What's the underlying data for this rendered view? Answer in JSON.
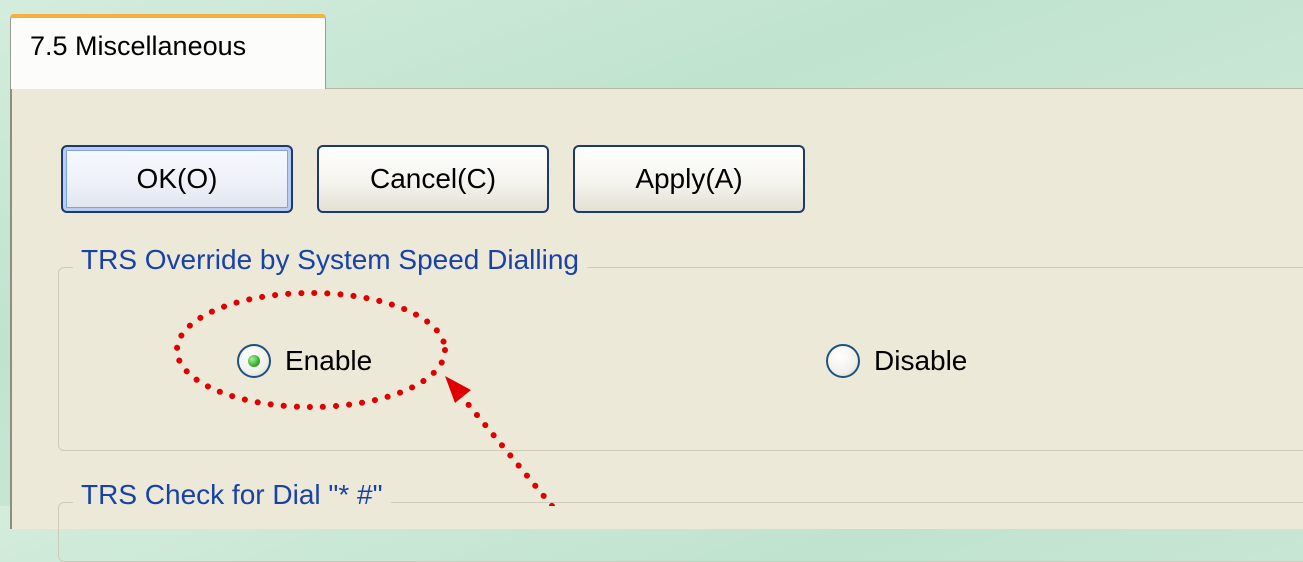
{
  "tab": {
    "label": "7.5 Miscellaneous"
  },
  "buttons": {
    "ok": "OK(O)",
    "cancel": "Cancel(C)",
    "apply": "Apply(A)"
  },
  "group1": {
    "legend": "TRS Override by System Speed Dialling",
    "options": [
      {
        "label": "Enable",
        "selected": true
      },
      {
        "label": "Disable",
        "selected": false
      }
    ]
  },
  "group2": {
    "legend": "TRS Check for Dial \"* #\""
  },
  "annotation": {
    "color": "#e00000"
  },
  "colors": {
    "panel": "#ece9d8",
    "legend_text": "#1a42a6",
    "tab_accent": "#f5b040"
  }
}
